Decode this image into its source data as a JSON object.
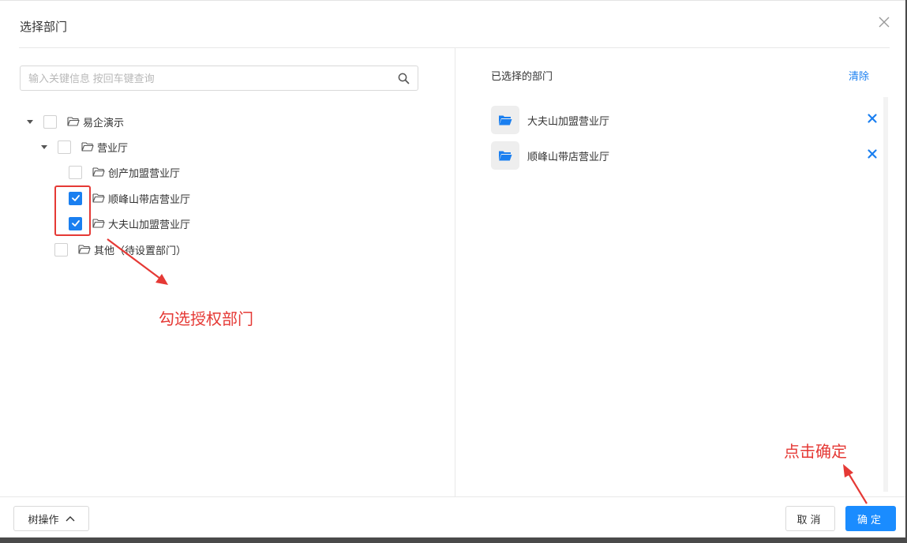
{
  "dialog": {
    "title": "选择部门"
  },
  "search": {
    "placeholder": "输入关键信息 按回车键查询"
  },
  "tree": {
    "nodes": [
      {
        "label": "易企演示",
        "checked": false,
        "expanded": true
      },
      {
        "label": "营业厅",
        "checked": false,
        "expanded": true
      },
      {
        "label": "创产加盟营业厅",
        "checked": false
      },
      {
        "label": "顺峰山带店营业厅",
        "checked": true
      },
      {
        "label": "大夫山加盟营业厅",
        "checked": true
      },
      {
        "label": "其他（待设置部门）",
        "checked": false
      }
    ]
  },
  "selected": {
    "title": "已选择的部门",
    "clear_label": "清除",
    "items": [
      {
        "label": "大夫山加盟营业厅"
      },
      {
        "label": "顺峰山带店营业厅"
      }
    ]
  },
  "footer": {
    "tree_op_label": "树操作",
    "cancel_label": "取消",
    "confirm_label": "确定"
  },
  "annotations": {
    "check_hint": "勾选授权部门",
    "confirm_hint": "点击确定"
  },
  "colors": {
    "accent": "#1a7ff0",
    "annotation": "#e53935"
  }
}
